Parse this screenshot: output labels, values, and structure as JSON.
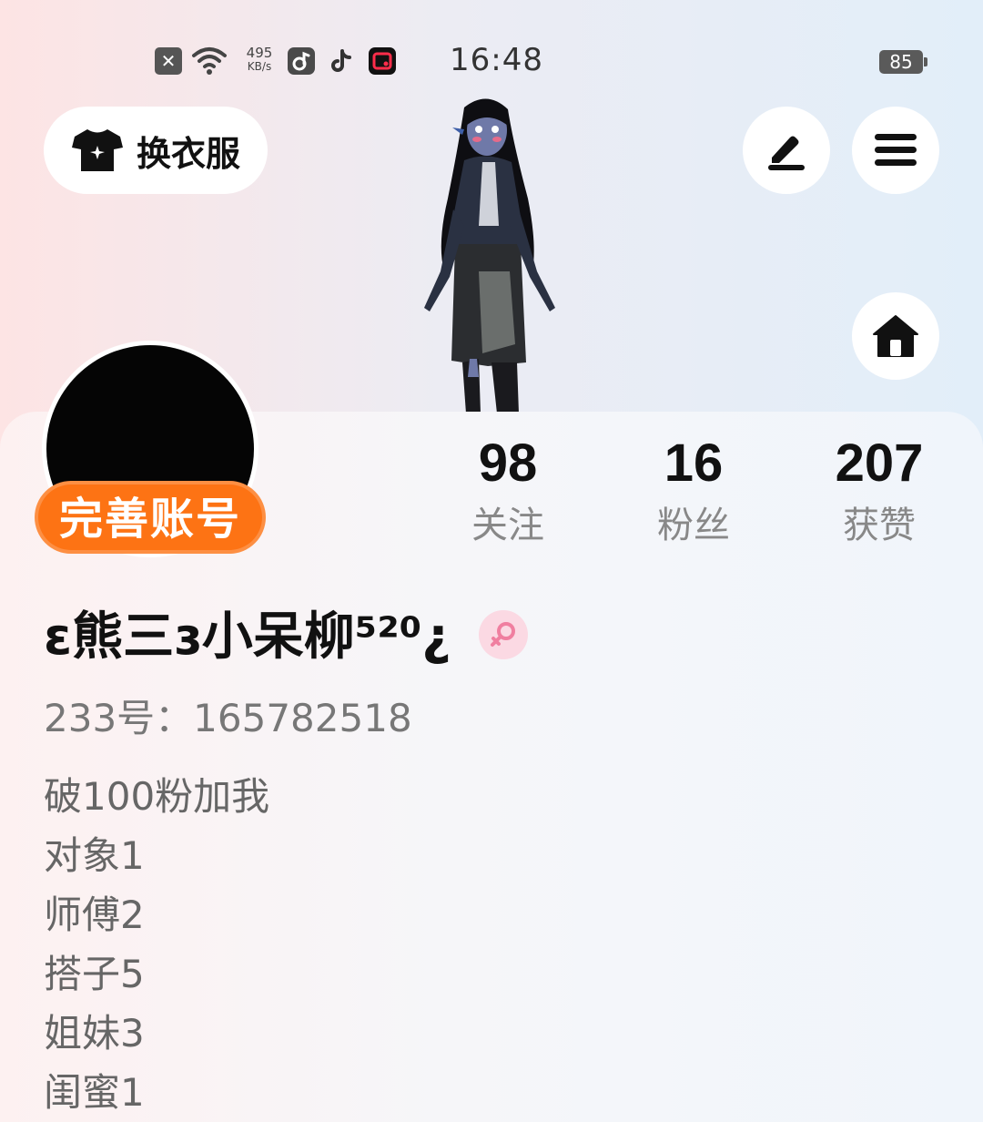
{
  "status_bar": {
    "net_speed": "495",
    "net_unit": "KB/s",
    "time": "16:48",
    "battery": "85",
    "icons": [
      "notification-close-icon",
      "wifi-icon",
      "music-app-icon",
      "tiktok-icon",
      "screen-record-icon"
    ]
  },
  "header": {
    "outfit_button_label": "换衣服",
    "icons": [
      "shirt-icon",
      "edit-icon",
      "menu-icon",
      "home-icon"
    ]
  },
  "profile": {
    "complete_account_label": "完善账号",
    "stats": [
      {
        "value": "98",
        "label": "关注"
      },
      {
        "value": "16",
        "label": "粉丝"
      },
      {
        "value": "207",
        "label": "获赞"
      }
    ],
    "nickname": "ɛ熊三ɜ小呆柳⁵²⁰¿",
    "gender_icon": "female-icon",
    "account_id": "233号：165782518",
    "bio_lines": [
      "破100粉加我",
      "对象1",
      "师傅2",
      "搭子5",
      "姐妹3",
      "闺蜜1"
    ]
  },
  "colors": {
    "accent_orange": "#fd7314",
    "gender_pink": "#fbd9e3",
    "gender_icon": "#f07fa0"
  }
}
